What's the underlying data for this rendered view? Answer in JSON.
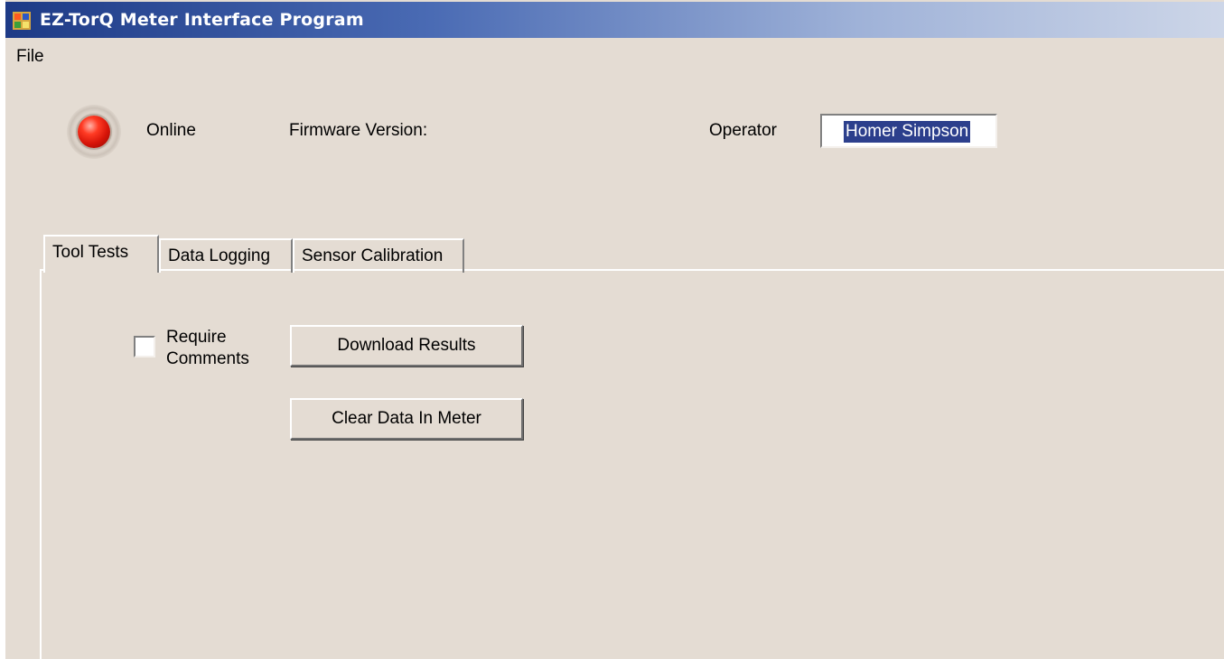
{
  "window": {
    "title": "EZ-TorQ Meter Interface Program",
    "icon": "app-window-icon"
  },
  "menu": {
    "items": [
      "File"
    ]
  },
  "status": {
    "indicator_icon": "red-led-icon",
    "indicator_color": "#d61408",
    "online_label": "Online"
  },
  "firmware": {
    "label": "Firmware Version:",
    "value": ""
  },
  "operator": {
    "label": "Operator",
    "value": "Homer Simpson"
  },
  "tabs": [
    {
      "label": "Tool Tests",
      "active": true
    },
    {
      "label": "Data Logging",
      "active": false
    },
    {
      "label": "Sensor Calibration",
      "active": false
    }
  ],
  "tool_tests": {
    "require_comments": {
      "label": "Require Comments",
      "checked": false
    },
    "download_button": "Download Results",
    "clear_button": "Clear Data In Meter"
  },
  "colors": {
    "titlebar_start": "#1d3a86",
    "background": "#e4dcd3",
    "selection": "#2c3f8c"
  }
}
